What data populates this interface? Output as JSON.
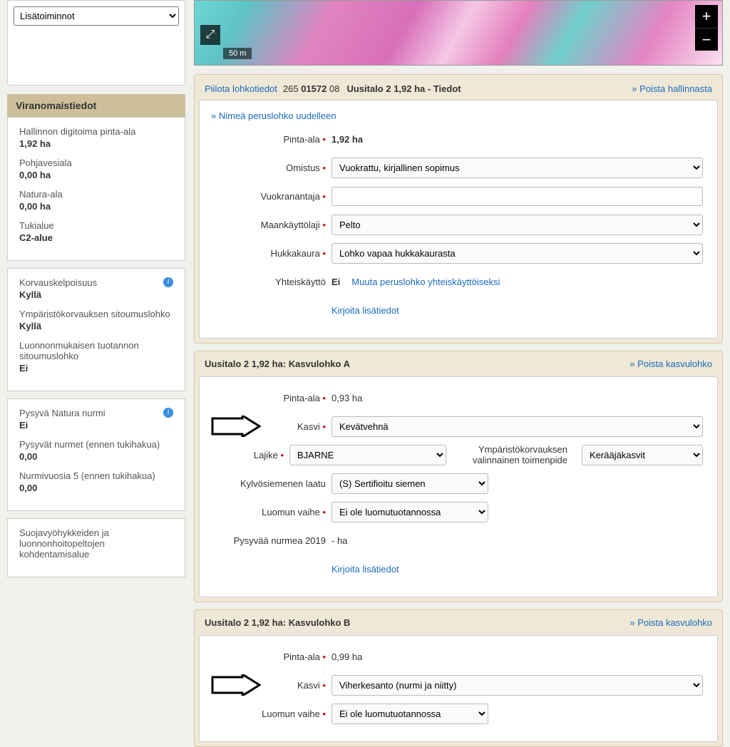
{
  "left": {
    "dropdown_placeholder": "Lisätoiminnot",
    "header": "Viranomaistiedot",
    "group1": [
      {
        "label": "Hallinnon digitoima pinta-ala",
        "value": "1,92 ha"
      },
      {
        "label": "Pohjavesiala",
        "value": "0,00 ha"
      },
      {
        "label": "Natura-ala",
        "value": "0,00 ha"
      },
      {
        "label": "Tukialue",
        "value": "C2-alue"
      }
    ],
    "group2": [
      {
        "label": "Korvauskelpoisuus",
        "value": "Kyllä",
        "info": true
      },
      {
        "label": "Ympäristökorvauksen sitoumuslohko",
        "value": "Kyllä"
      },
      {
        "label": "Luonnonmukaisen tuotannon sitoumuslohko",
        "value": "Ei"
      }
    ],
    "group3": [
      {
        "label": "Pysyvä Natura nurmi",
        "value": "Ei",
        "info": true
      },
      {
        "label": "Pysyvät nurmet (ennen tukihakua)",
        "value": "0,00"
      },
      {
        "label": "Nurmivuosia 5 (ennen tukihakua)",
        "value": "0,00"
      }
    ],
    "group4": [
      {
        "label": "Suojavyöhykkeiden ja luonnonhoitopeltojen kohdentamisalue",
        "value": ""
      }
    ]
  },
  "map": {
    "zoom_in": "+",
    "zoom_out": "−",
    "fullscreen": "⤢",
    "scale": "50 m"
  },
  "lohko": {
    "hide_link": "Piilota lohkotiedot",
    "id_prefix": "265 ",
    "id_bold": "01572",
    "id_suffix": " 08",
    "title": "Uusitalo 2 1,92 ha - Tiedot",
    "remove": "» Poista hallinnasta",
    "rename": "» Nimeä peruslohko uudelleen",
    "pinta_ala_label": "Pinta-ala",
    "pinta_ala_value": "1,92 ha",
    "omistus_label": "Omistus",
    "omistus_value": "Vuokrattu, kirjallinen sopimus",
    "vuokranantaja_label": "Vuokranantaja",
    "maankayttolaji_label": "Maankäyttölaji",
    "maankayttolaji_value": "Pelto",
    "hukkakaura_label": "Hukkakaura",
    "hukkakaura_value": "Lohko vapaa hukkakaurasta",
    "yhteiskaytto_label": "Yhteiskäyttö",
    "yhteiskaytto_value": "Ei",
    "yhteiskaytto_link": "Muuta peruslohko yhteiskäyttöiseksi",
    "lisatiedot_link": "Kirjoita lisätiedot"
  },
  "kasvuA": {
    "title": "Uusitalo 2 1,92 ha: Kasvulohko A",
    "remove": "» Poista kasvulohko",
    "pinta_ala_label": "Pinta-ala",
    "pinta_ala_value": "0,93  ha",
    "kasvi_label": "Kasvi",
    "kasvi_value": "Kevätvehnä",
    "lajike_label": "Lajike",
    "lajike_value": "BJARNE",
    "ymparisto_label": "Ympäristökorvauksen valinnainen toimenpide",
    "ymparisto_value": "Kerääjäkasvit",
    "kylvo_label": "Kylvösiemenen laatu",
    "kylvo_value": "(S) Sertifioitu siemen",
    "luomu_label": "Luomun vaihe",
    "luomu_value": "Ei ole luomutuotannossa",
    "pysyva_label": "Pysyvää nurmea 2019",
    "pysyva_value": "- ha",
    "lisatiedot_link": "Kirjoita lisätiedot"
  },
  "kasvuB": {
    "title": "Uusitalo 2 1,92 ha: Kasvulohko B",
    "remove": "» Poista kasvulohko",
    "pinta_ala_label": "Pinta-ala",
    "pinta_ala_value": "0,99  ha",
    "kasvi_label": "Kasvi",
    "kasvi_value": "Viherkesanto (nurmi ja niitty)",
    "luomu_label": "Luomun vaihe",
    "luomu_value": "Ei ole luomutuotannossa"
  }
}
